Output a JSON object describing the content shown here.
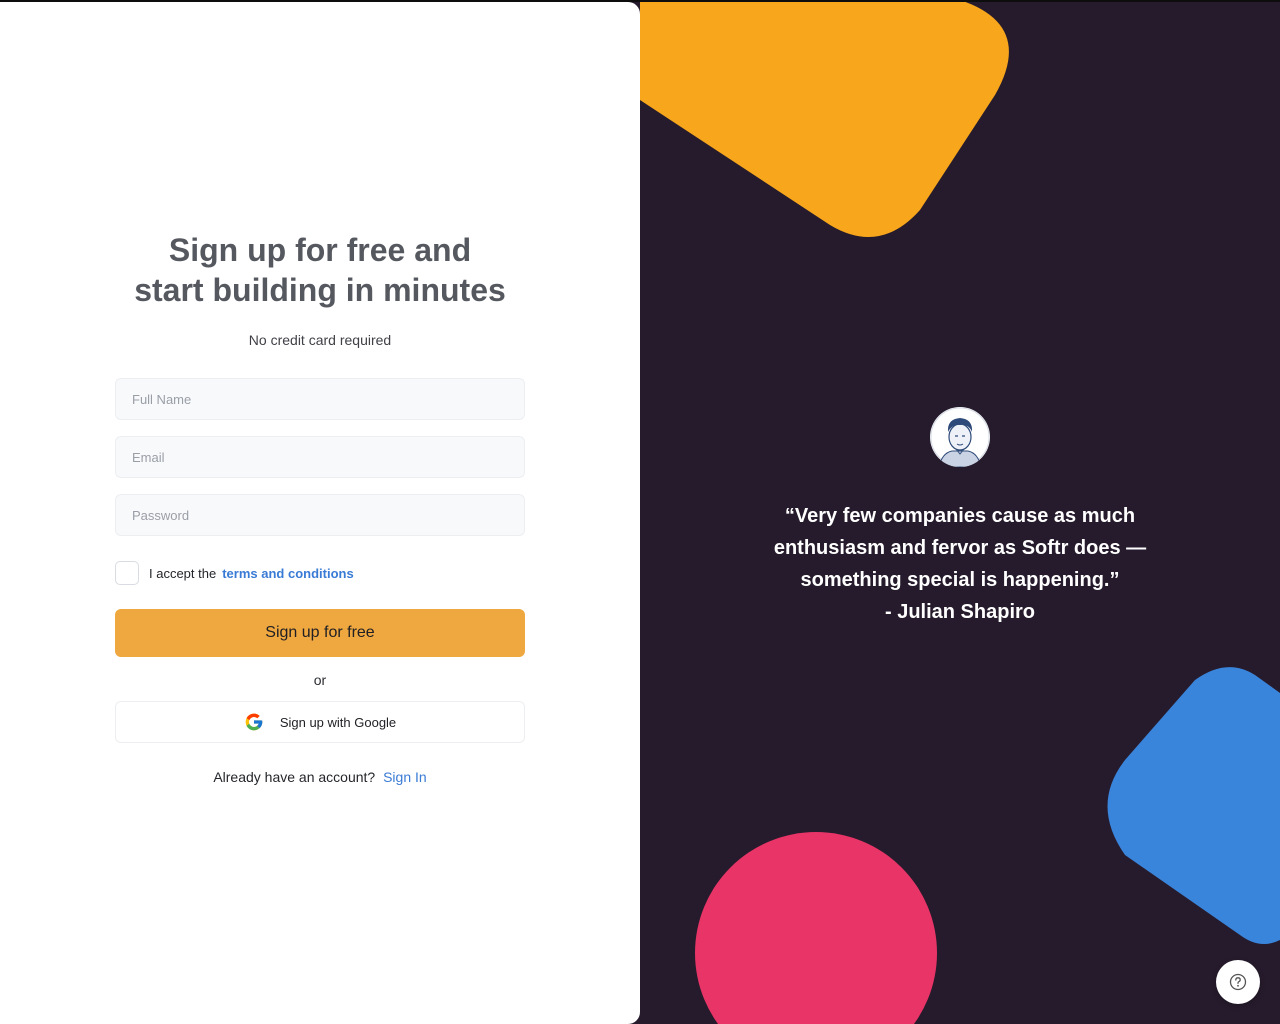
{
  "signup": {
    "heading": "Sign up for free and\nstart building in minutes",
    "subtitle": "No credit card required",
    "full_name_placeholder": "Full Name",
    "email_placeholder": "Email",
    "password_placeholder": "Password",
    "terms_prefix": "I accept the",
    "terms_link": "terms and conditions",
    "submit_label": "Sign up for free",
    "or_label": "or",
    "google_label": "Sign up with Google",
    "has_account_text": "Already have an account?",
    "signin_link": "Sign In"
  },
  "testimonial": {
    "quote": "“Very few companies cause as much enthusiasm and fervor as Softr does — something special is happening.”",
    "author": "- Julian Shapiro"
  },
  "icons": {
    "google": "google-logo-icon",
    "help": "question-circle-icon",
    "avatar": "portrait-illustration"
  },
  "colors": {
    "panel_background": "#261b2c",
    "primary_button": "#efa73f",
    "link": "#3a7bd5",
    "shape_orange": "#f8a71c",
    "shape_blue": "#3a85dc",
    "shape_pink": "#e83467"
  }
}
